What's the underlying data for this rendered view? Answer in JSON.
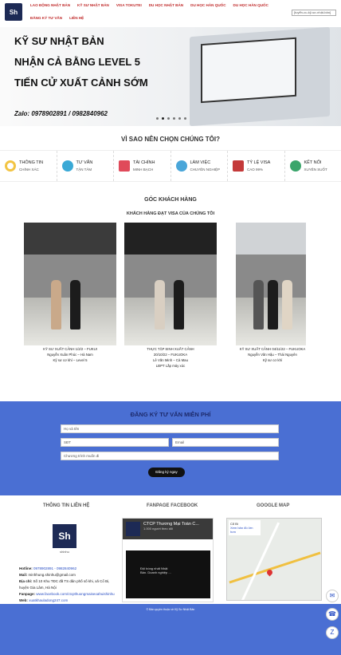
{
  "brand": {
    "logo": "Sh"
  },
  "nav": [
    "LAO ĐỘNG NHẬT BẢN",
    "KỸ SƯ NHẬT BẢN",
    "VISA TOKUTEI",
    "DU HỌC NHẬT BẢN",
    "DU HỌC HÀN QUỐC",
    "DU HỌC HÀN QUỐC",
    "ĐĂNG KÝ TƯ VẤN",
    "LIÊN HỆ"
  ],
  "search": {
    "placeholder": "[tuyển-cu-kỹ-sư-nhật-bản]"
  },
  "hero": {
    "line1": "KỸ SƯ NHẬT BẢN",
    "line2": "NHẬN CẢ BẰNG LEVEL 5",
    "line3": "TIẾN CỬ XUẤT CẢNH SỚM",
    "zalo": "Zalo: 0978902891 / 0982840962"
  },
  "why": {
    "title": "VÌ SAO NÊN CHỌN CHÚNG TÔI?",
    "items": [
      {
        "title": "THÔNG TIN",
        "sub": "CHÍNH XÁC",
        "color": "#f2c443"
      },
      {
        "title": "TƯ VẤN",
        "sub": "TẬN TÂM",
        "color": "#3aa9d6"
      },
      {
        "title": "TÀI CHÍNH",
        "sub": "MINH BẠCH",
        "color": "#e04a5a"
      },
      {
        "title": "LÀM VIỆC",
        "sub": "CHUYÊN NGHIỆP",
        "color": "#4aa6d9"
      },
      {
        "title": "TỶ LỆ VISA",
        "sub": "CAO 99%",
        "color": "#c43a3a"
      },
      {
        "title": "KẾT NỐI",
        "sub": "XUYÊN SUỐT",
        "color": "#3aa56b"
      }
    ]
  },
  "customers": {
    "title": "GÓC KHÁCH HÀNG",
    "subtitle": "KHÁCH HÀNG ĐẠT VISA CỦA CHÚNG TÔI",
    "cards": [
      {
        "l1": "KỸ SƯ XUẤT CẢNH 1/2/2 – FUKUI",
        "l2": "Nguyễn Xuân Phúc – Hà Nam",
        "l3": "Kỹ sư cơ khí – Level 5"
      },
      {
        "l1": "THỰC TẬP SINH XUẤT CẢNH",
        "l2": "20/10/22 – FUKUOKA",
        "l3": "Lê Văn Minh – Cà Mau",
        "l4": "LĐPT Lắp máy xúc"
      },
      {
        "l1": "KỸ SƯ XUẤT CẢNH 04/11/22 – FUKUOKA",
        "l2": "Nguyễn Văn Hậu – Thái Nguyên",
        "l3": "Kỹ sư cơ khí"
      }
    ]
  },
  "form": {
    "title": "ĐĂNG KÝ TƯ VẤN MIỄN PHÍ",
    "name": "Họ và tên",
    "phone": "SĐT",
    "email": "Email",
    "program": "Chương trình muốn đi",
    "submit": "Đăng ký ngay"
  },
  "footer": {
    "contact_title": "THÔNG TIN LIÊN HỆ",
    "fanpage_title": "FANPAGE FACEBOOK",
    "map_title": "GOOGLE MAP",
    "brand": "Sh",
    "brand_sub": "shinhu",
    "hotline_label": "Hotline:",
    "hotline": "0978902891 - 0982840962",
    "mail_label": "Mail:",
    "mail": "minhhung.shinhu@gmail.com",
    "addr_label": "Địa chỉ:",
    "addr": "Số 10 Khu TĐC đã TS dân phố số khi, xã Cổ Bi, huyện Gia Lâm, Hà Nội",
    "fanpage_label": "Fanpage:",
    "fanpage": "www.facebook.com/ctcpthuongmaiseoahuishinhu",
    "web_label": "Web:",
    "web": "xuatkhauladong247.com",
    "fb_name": "CTCP Thương Mại Toàn C...",
    "fb_sub": "1.000 người theo dõi",
    "fb_video": "Đội bóng nhất Nhật Bản. Doanh nghiệp ...",
    "map_place": "Cổ Bi",
    "map_link": "Xem bản đồ lớn hơn"
  },
  "copyright": "© Bản quyền thuộc về Kỹ Sư Nhật Bản"
}
